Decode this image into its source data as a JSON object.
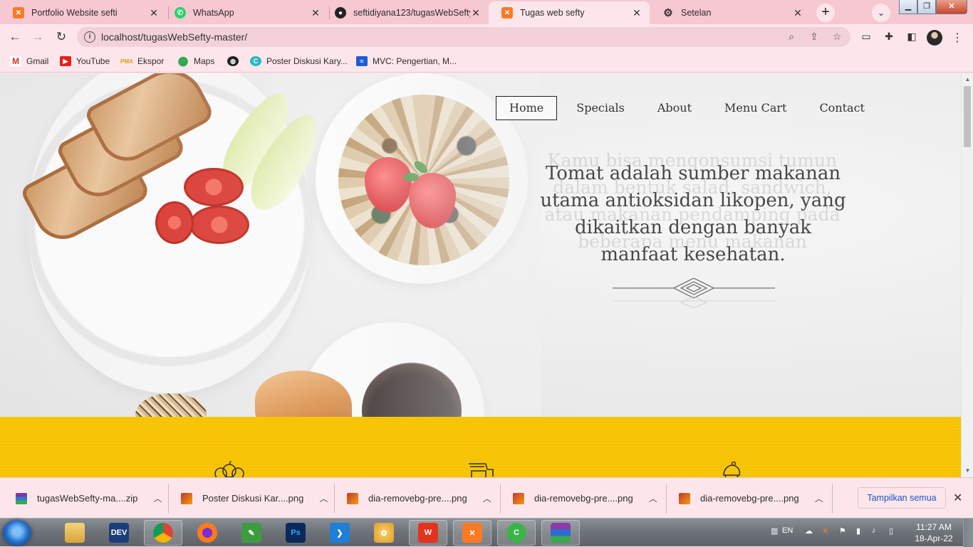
{
  "browser": {
    "tabs": [
      {
        "title": "Portfolio Website sefti",
        "icon": "xampp-icon"
      },
      {
        "title": "WhatsApp",
        "icon": "whatsapp-icon"
      },
      {
        "title": "seftidiyana123/tugasWebSefty",
        "icon": "github-icon"
      },
      {
        "title": "Tugas web sefty",
        "icon": "xampp-icon"
      },
      {
        "title": "Setelan",
        "icon": "gear-icon"
      }
    ],
    "url": "localhost/tugasWebSefty-master/",
    "bookmarks": [
      {
        "label": "Gmail",
        "icon": "gmail-icon"
      },
      {
        "label": "YouTube",
        "icon": "youtube-icon"
      },
      {
        "label": "Ekspor",
        "icon": "pma-icon"
      },
      {
        "label": "Maps",
        "icon": "maps-icon"
      },
      {
        "label": "",
        "icon": "globe-icon"
      },
      {
        "label": "Poster Diskusi Kary...",
        "icon": "canva-icon"
      },
      {
        "label": "MVC: Pengertian, M...",
        "icon": "chart-icon"
      }
    ]
  },
  "page": {
    "nav": [
      "Home",
      "Specials",
      "About",
      "Menu Cart",
      "Contact"
    ],
    "hero_main": "Tomat adalah sumber makanan utama antioksidan likopen, yang dikaitkan dengan banyak manfaat kesehatan.",
    "hero_ghost": "Kamu bisa mengonsumsi tumun dalam bentuk salad, sandwich, atau makanan pendamping pada beberapa menu makanan"
  },
  "downloads": {
    "items": [
      "tugasWebSefty-ma....zip",
      "Poster Diskusi Kar....png",
      "dia-removebg-pre....png",
      "dia-removebg-pre....png",
      "dia-removebg-pre....png"
    ],
    "show_all": "Tampilkan semua"
  },
  "taskbar": {
    "lang": "EN",
    "time": "11:27 AM",
    "date": "18-Apr-22"
  },
  "colors": {
    "tab_strip": "#f6c8d2",
    "toolbar": "#fde6eb",
    "accent_yellow": "#f5c300"
  }
}
